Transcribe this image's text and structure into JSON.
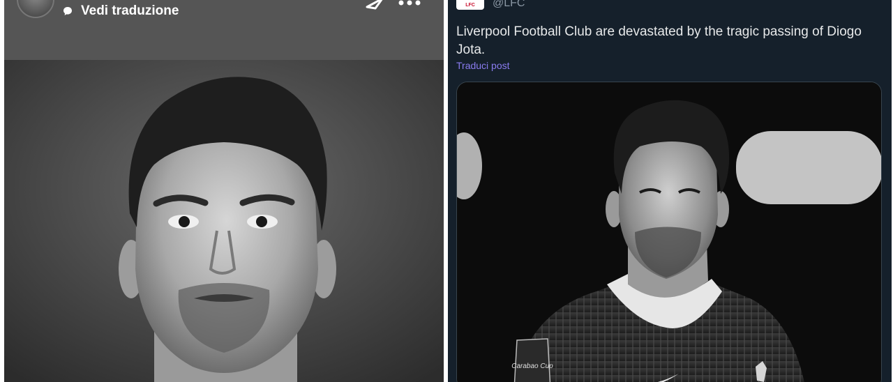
{
  "left_story": {
    "translate_label": "Vedi traduzione",
    "icons": [
      "avatar",
      "speech-bubble-icon",
      "send-icon",
      "more-options-icon"
    ],
    "photo": "player-portrait-bw"
  },
  "right_post": {
    "logo_text": "LFC",
    "handle": "@LFC",
    "text": "Liverpool Football Club are devastated by the tragic passing of Diogo Jota.",
    "translate_link": "Traduci post",
    "shirt_badge_text": "Carabao Cup",
    "colors": {
      "background": "#15202b",
      "text": "#e7e9ea",
      "muted": "#8b98a5",
      "link": "#8a7cf0"
    }
  }
}
